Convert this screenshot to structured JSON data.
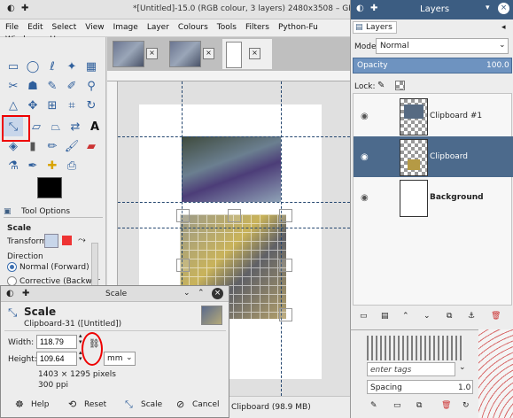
{
  "window": {
    "title": "*[Untitled]-15.0 (RGB colour, 3 layers) 2480x3508 – GIMP"
  },
  "menu": [
    "File",
    "Edit",
    "Select",
    "View",
    "Image",
    "Layer",
    "Colours",
    "Tools",
    "Filters",
    "Python-Fu",
    "Windows",
    "H"
  ],
  "status": {
    "text": "Clipboard (98.9 MB)"
  },
  "tool_options": {
    "tab_label": "Tool Options",
    "section": "Scale",
    "transform_label": "Transform:",
    "direction_label": "Direction",
    "direction_normal": "Normal (Forward)",
    "direction_corrective": "Corrective (Backwar"
  },
  "scale_dialog": {
    "title": "Scale",
    "heading": "Scale",
    "subtitle": "Clipboard-31 ([Untitled])",
    "width_label": "Width:",
    "width_value": "118.79",
    "height_label": "Height:",
    "height_value": "109.64",
    "unit": "mm",
    "pixels": "1403 × 1295 pixels",
    "ppi": "300 ppi",
    "buttons": {
      "help": "Help",
      "reset": "Reset",
      "scale": "Scale",
      "cancel": "Cancel"
    }
  },
  "layers": {
    "window_title": "Layers",
    "tab": "Layers",
    "mode_label": "Mode:",
    "mode_value": "Normal",
    "opacity_label": "Opacity",
    "opacity_value": "100.0",
    "lock_label": "Lock:",
    "items": [
      {
        "name": "Clipboard #1",
        "selected": false
      },
      {
        "name": "Clipboard",
        "selected": true
      },
      {
        "name": "Background",
        "selected": false
      }
    ]
  },
  "brushes": {
    "tags_placeholder": "enter tags",
    "spacing_label": "Spacing",
    "spacing_value": "1.0"
  },
  "colors": {
    "accent": "#3c5d82",
    "selected_row": "#4c6a8c",
    "highlight_red": "#e00000"
  }
}
